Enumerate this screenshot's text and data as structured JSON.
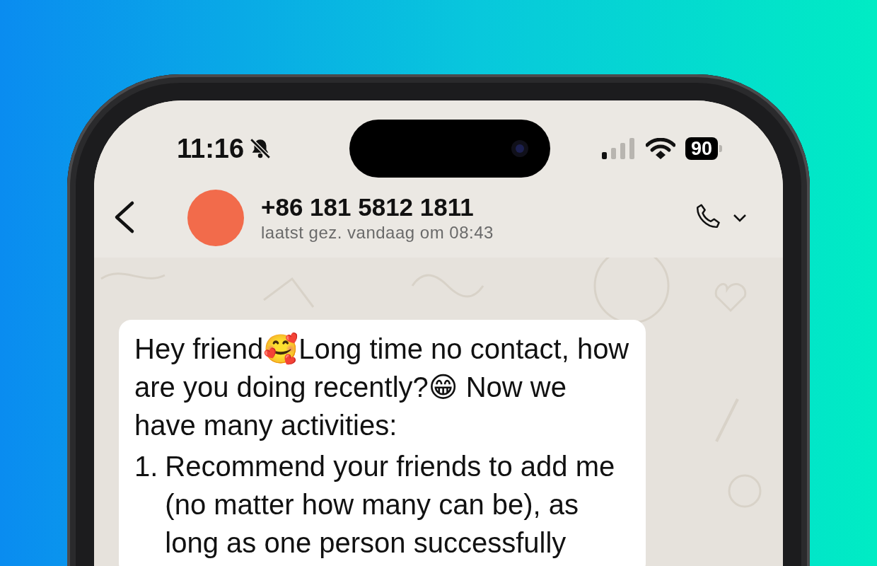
{
  "status_bar": {
    "time": "11:16",
    "silent": true,
    "battery": "90"
  },
  "chat_header": {
    "contact": "+86 181 5812 1811",
    "last_seen": "laatst gez. vandaag om 08:43"
  },
  "message": {
    "intro": "Hey friend🥰Long time no contact, how are you doing recently?😁  Now we have many activities:",
    "items": [
      {
        "number": "1.",
        "text": "Recommend your friends to add me (no matter how many can be), as long as one person successfully"
      }
    ]
  }
}
